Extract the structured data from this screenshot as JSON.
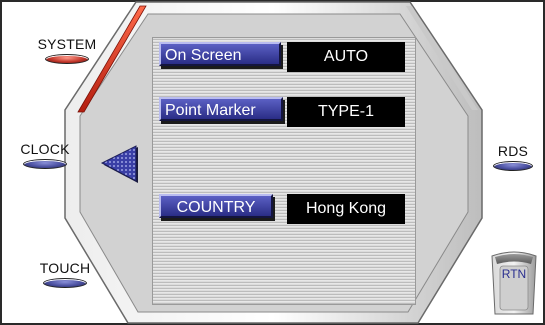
{
  "left_buttons": {
    "system": "SYSTEM",
    "clock": "CLOCK",
    "touch": "TOUCH"
  },
  "right_buttons": {
    "rds": "RDS",
    "rtn": "RTN"
  },
  "settings": [
    {
      "label": "On Screen",
      "value": "AUTO"
    },
    {
      "label": "Point Marker",
      "value": "TYPE-1"
    },
    {
      "label": "COUNTRY",
      "value": "Hong Kong"
    }
  ],
  "icons": {
    "back": "triangle-left-icon",
    "return": "return-key-icon"
  },
  "colors": {
    "accent_red": "#e0452c",
    "label_blue": "#3a3fa6",
    "value_bg": "#000000"
  }
}
